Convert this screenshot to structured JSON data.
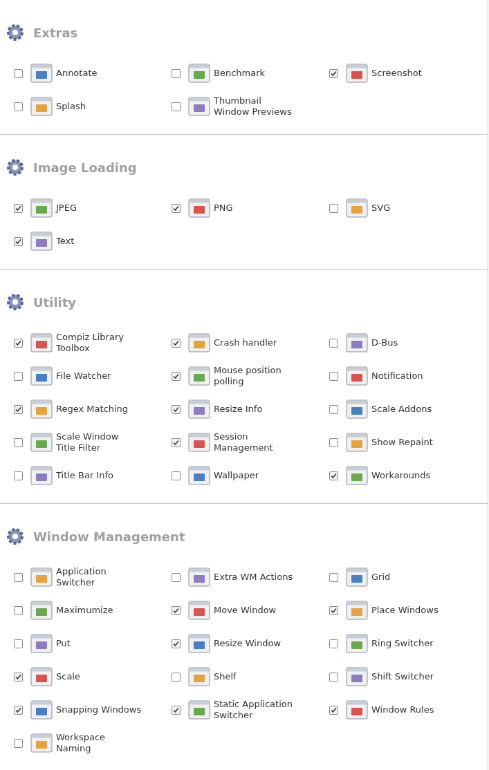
{
  "sections": [
    {
      "title": "Extras",
      "plugins": [
        {
          "label": "Annotate",
          "checked": false
        },
        {
          "label": "Benchmark",
          "checked": false
        },
        {
          "label": "Screenshot",
          "checked": true
        },
        {
          "label": "Splash",
          "checked": false
        },
        {
          "label": "Thumbnail\nWindow Previews",
          "checked": false
        }
      ]
    },
    {
      "title": "Image Loading",
      "plugins": [
        {
          "label": "JPEG",
          "checked": true
        },
        {
          "label": "PNG",
          "checked": true
        },
        {
          "label": "SVG",
          "checked": false
        },
        {
          "label": "Text",
          "checked": true
        }
      ]
    },
    {
      "title": "Utility",
      "plugins": [
        {
          "label": "Compiz Library\nToolbox",
          "checked": true
        },
        {
          "label": "Crash handler",
          "checked": true
        },
        {
          "label": "D-Bus",
          "checked": false
        },
        {
          "label": "File Watcher",
          "checked": false
        },
        {
          "label": "Mouse position\npolling",
          "checked": true
        },
        {
          "label": "Notification",
          "checked": false
        },
        {
          "label": "Regex Matching",
          "checked": true
        },
        {
          "label": "Resize Info",
          "checked": true
        },
        {
          "label": "Scale Addons",
          "checked": false
        },
        {
          "label": "Scale Window\nTitle Filter",
          "checked": false
        },
        {
          "label": "Session\nManagement",
          "checked": true
        },
        {
          "label": "Show Repaint",
          "checked": false
        },
        {
          "label": "Title Bar Info",
          "checked": false
        },
        {
          "label": "Wallpaper",
          "checked": false
        },
        {
          "label": "Workarounds",
          "checked": true
        }
      ]
    },
    {
      "title": "Window Management",
      "plugins": [
        {
          "label": "Application\nSwitcher",
          "checked": false
        },
        {
          "label": "Extra WM Actions",
          "checked": false
        },
        {
          "label": "Grid",
          "checked": false
        },
        {
          "label": "Maximumize",
          "checked": false
        },
        {
          "label": "Move Window",
          "checked": true
        },
        {
          "label": "Place Windows",
          "checked": true
        },
        {
          "label": "Put",
          "checked": false
        },
        {
          "label": "Resize Window",
          "checked": true
        },
        {
          "label": "Ring Switcher",
          "checked": false
        },
        {
          "label": "Scale",
          "checked": true
        },
        {
          "label": "Shelf",
          "checked": false
        },
        {
          "label": "Shift Switcher",
          "checked": false
        },
        {
          "label": "Snapping Windows",
          "checked": true
        },
        {
          "label": "Static Application\nSwitcher",
          "checked": true
        },
        {
          "label": "Window Rules",
          "checked": true
        },
        {
          "label": "Workspace\nNaming",
          "checked": false
        }
      ]
    }
  ]
}
